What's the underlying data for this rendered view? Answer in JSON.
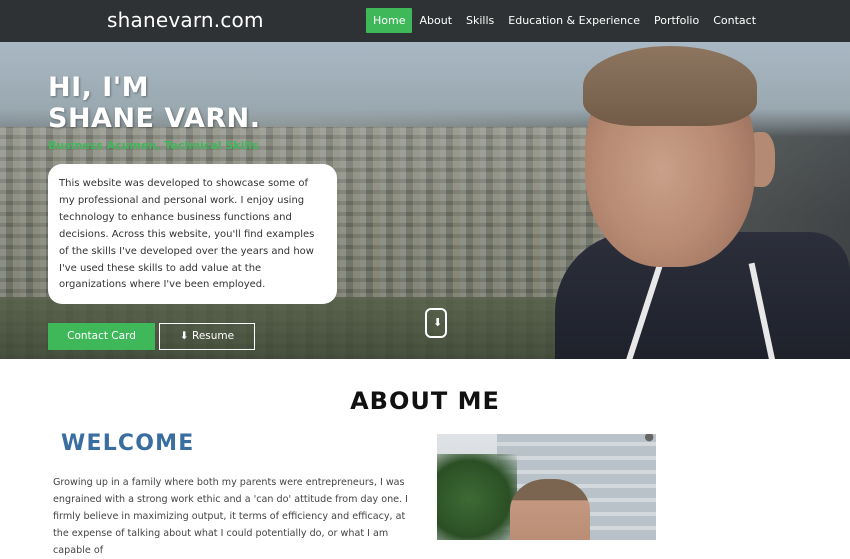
{
  "nav": {
    "brand": "shanevarn.com",
    "items": [
      {
        "label": "Home",
        "active": true
      },
      {
        "label": "About",
        "active": false
      },
      {
        "label": "Skills",
        "active": false
      },
      {
        "label": "Education & Experience",
        "active": false
      },
      {
        "label": "Portfolio",
        "active": false
      },
      {
        "label": "Contact",
        "active": false
      }
    ]
  },
  "hero": {
    "title_line1": "HI, I'M",
    "title_line2": "SHANE VARN.",
    "subtitle": "Business Acumen, Technical Skills",
    "intro": "This website was developed to showcase some of my professional and personal work. I enjoy using technology to enhance business functions and decisions. Across this website, you'll find examples of the skills I've developed over the years and how I've used these skills to add value at the organizations where I've been employed.",
    "contact_button": "Contact Card",
    "resume_button": "Resume",
    "resume_icon": "download-icon",
    "scroll_icon": "scroll-down-icon"
  },
  "about": {
    "heading": "ABOUT ME",
    "welcome": "WELCOME",
    "text": "Growing up in a family where both my parents were entrepreneurs, I was engrained with a strong work ethic and a 'can do' attitude from day one. I firmly believe in maximizing output, it terms of efficiency and efficacy, at the expense of talking about what I could potentially do, or what I am capable of"
  },
  "colors": {
    "accent_green": "#3fb85a",
    "nav_bg": "#2f3234",
    "welcome_blue": "#3b6ea0"
  }
}
